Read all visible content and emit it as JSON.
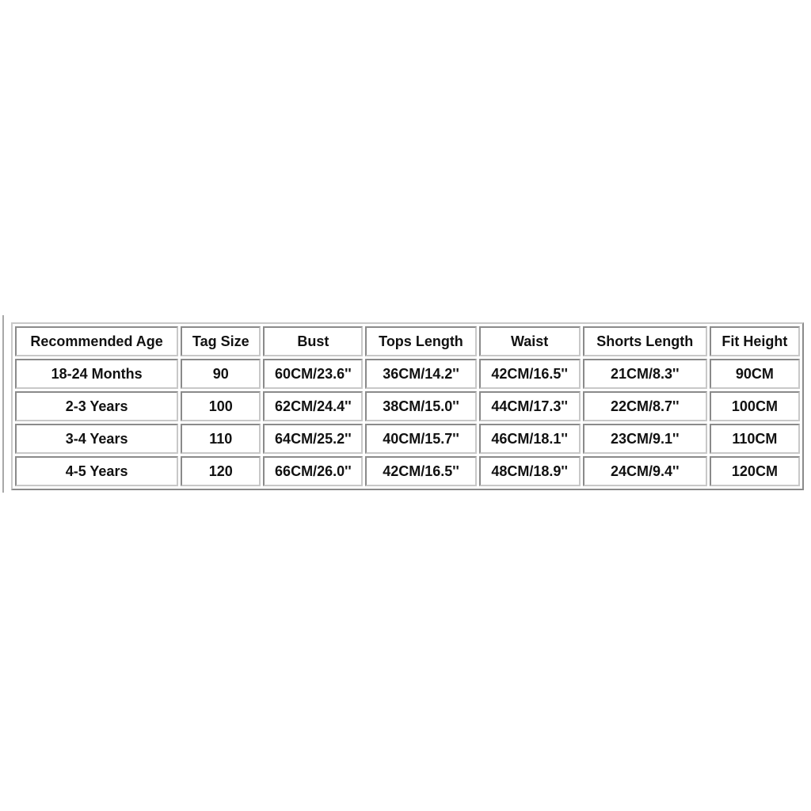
{
  "size_chart": {
    "headers": [
      "Recommended Age",
      "Tag Size",
      "Bust",
      "Tops Length",
      "Waist",
      "Shorts Length",
      "Fit Height"
    ],
    "rows": [
      [
        "18-24 Months",
        "90",
        "60CM/23.6''",
        "36CM/14.2''",
        "42CM/16.5''",
        "21CM/8.3''",
        "90CM"
      ],
      [
        "2-3 Years",
        "100",
        "62CM/24.4''",
        "38CM/15.0''",
        "44CM/17.3''",
        "22CM/8.7''",
        "100CM"
      ],
      [
        "3-4 Years",
        "110",
        "64CM/25.2''",
        "40CM/15.7''",
        "46CM/18.1''",
        "23CM/9.1''",
        "110CM"
      ],
      [
        "4-5 Years",
        "120",
        "66CM/26.0''",
        "42CM/16.5''",
        "48CM/18.9''",
        "24CM/9.4''",
        "120CM"
      ]
    ]
  }
}
